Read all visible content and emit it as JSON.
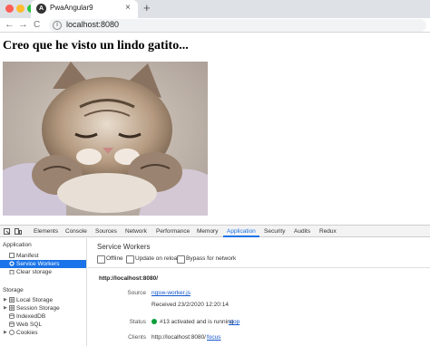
{
  "browser": {
    "tab_title": "PwaAngular9",
    "tab_close": "×",
    "new_tab": "+",
    "url": "localhost:8080",
    "back": "←",
    "forward": "→",
    "reload": "C",
    "info": "i"
  },
  "page": {
    "heading": "Creo que he visto un lindo gatito..."
  },
  "devtools": {
    "tabs": [
      "Elements",
      "Console",
      "Sources",
      "Network",
      "Performance",
      "Memory",
      "Application",
      "Security",
      "Audits",
      "Redux"
    ],
    "active_tab": "Application",
    "sidebar": {
      "application_header": "Application",
      "application_items": [
        "Manifest",
        "Service Workers",
        "Clear storage"
      ],
      "selected_item": "Service Workers",
      "storage_header": "Storage",
      "storage_items": [
        "Local Storage",
        "Session Storage",
        "IndexedDB",
        "Web SQL",
        "Cookies"
      ]
    },
    "service_workers": {
      "title": "Service Workers",
      "checkboxes": [
        "Offline",
        "Update on reload",
        "Bypass for network"
      ],
      "origin": "http://localhost:8080/",
      "source_label": "Source",
      "source_link": "ngsw-worker.js",
      "received": "Received 23/2/2020 12:20:14",
      "status_label": "Status",
      "status_text": "#13 activated and is running",
      "stop_link": "stop",
      "clients_label": "Clients",
      "clients_text": "http://localhost:8080/",
      "focus_link": "focus"
    }
  }
}
